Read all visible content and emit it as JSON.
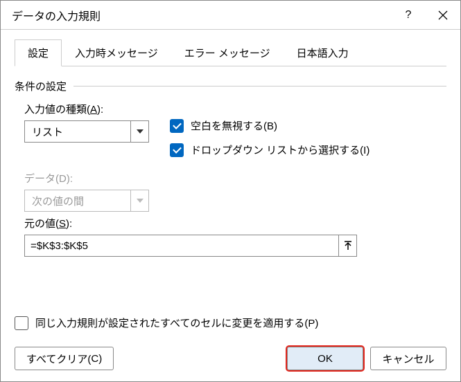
{
  "title": "データの入力規則",
  "tabs": {
    "settings": "設定",
    "input_msg": "入力時メッセージ",
    "error_msg": "エラー メッセージ",
    "ime": "日本語入力"
  },
  "section": {
    "title": "条件の設定"
  },
  "allow": {
    "label_pre": "入力値の種類(",
    "label_hk": "A",
    "label_post": "):",
    "value": "リスト"
  },
  "data_sel": {
    "label_pre": "データ(",
    "label_hk": "D",
    "label_post": "):",
    "value": "次の値の間"
  },
  "ignore_blank": {
    "label_pre": "空白を無視する(",
    "label_hk": "B",
    "label_post": ")"
  },
  "dropdown": {
    "label_pre": "ドロップダウン リストから選択する(",
    "label_hk": "I",
    "label_post": ")"
  },
  "source": {
    "label_pre": "元の値(",
    "label_hk": "S",
    "label_post": "):",
    "value": "=$K$3:$K$5"
  },
  "apply_all": {
    "label_pre": "同じ入力規則が設定されたすべてのセルに変更を適用する(",
    "label_hk": "P",
    "label_post": ")"
  },
  "buttons": {
    "clear_pre": "すべてクリア(",
    "clear_hk": "C",
    "clear_post": ")",
    "ok": "OK",
    "cancel": "キャンセル"
  }
}
